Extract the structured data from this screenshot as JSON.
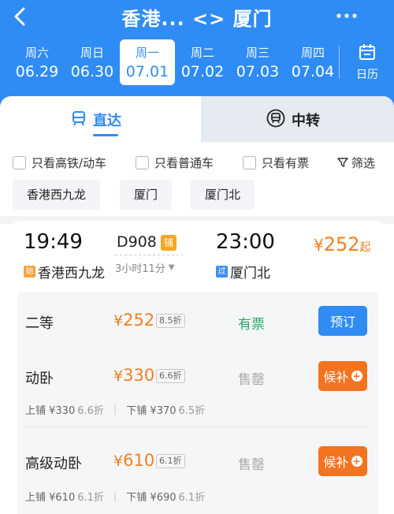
{
  "header": {
    "title": "香港... <> 厦门",
    "dates": [
      {
        "weekday": "周六",
        "date": "06.29",
        "active": false
      },
      {
        "weekday": "周日",
        "date": "06.30",
        "active": false
      },
      {
        "weekday": "周一",
        "date": "07.01",
        "active": true
      },
      {
        "weekday": "周二",
        "date": "07.02",
        "active": false
      },
      {
        "weekday": "周三",
        "date": "07.03",
        "active": false
      },
      {
        "weekday": "周四",
        "date": "07.04",
        "active": false
      }
    ],
    "calendar_label": "日历"
  },
  "tabs": {
    "direct": "直达",
    "transfer": "中转"
  },
  "filters": {
    "high_speed": "只看高铁/动车",
    "normal": "只看普通车",
    "available": "只看有票",
    "screen": "筛选"
  },
  "stations": [
    "香港西九龙",
    "厦门",
    "厦门北"
  ],
  "train": {
    "dep_time": "19:49",
    "arr_time": "23:00",
    "number": "D908",
    "bed_badge": "铺",
    "duration": "3小时11分",
    "price_symbol": "¥",
    "price": "252",
    "price_suffix": "起",
    "dep_tag": "始",
    "dep_station": "香港西九龙",
    "arr_tag": "过",
    "arr_station": "厦门北"
  },
  "seats": [
    {
      "name": "二等",
      "price": "252",
      "discount": "8.5折",
      "status": "有票",
      "action": "预订"
    },
    {
      "name": "动卧",
      "price": "330",
      "discount": "6.6折",
      "status": "售罄",
      "action": "候补",
      "upper": "上铺 ¥330",
      "upper_d": "6.6折",
      "lower": "下铺 ¥370",
      "lower_d": "6.5折"
    },
    {
      "name": "高级动卧",
      "price": "610",
      "discount": "6.1折",
      "status": "售罄",
      "action": "候补",
      "upper": "上铺 ¥610",
      "upper_d": "6.1折",
      "lower": "下铺 ¥690",
      "lower_d": "6.1折"
    }
  ],
  "currency": "¥",
  "colors": {
    "primary": "#2f8cf4",
    "price": "#f0801f",
    "waitlist": "#f37320",
    "available": "#27a96b"
  }
}
